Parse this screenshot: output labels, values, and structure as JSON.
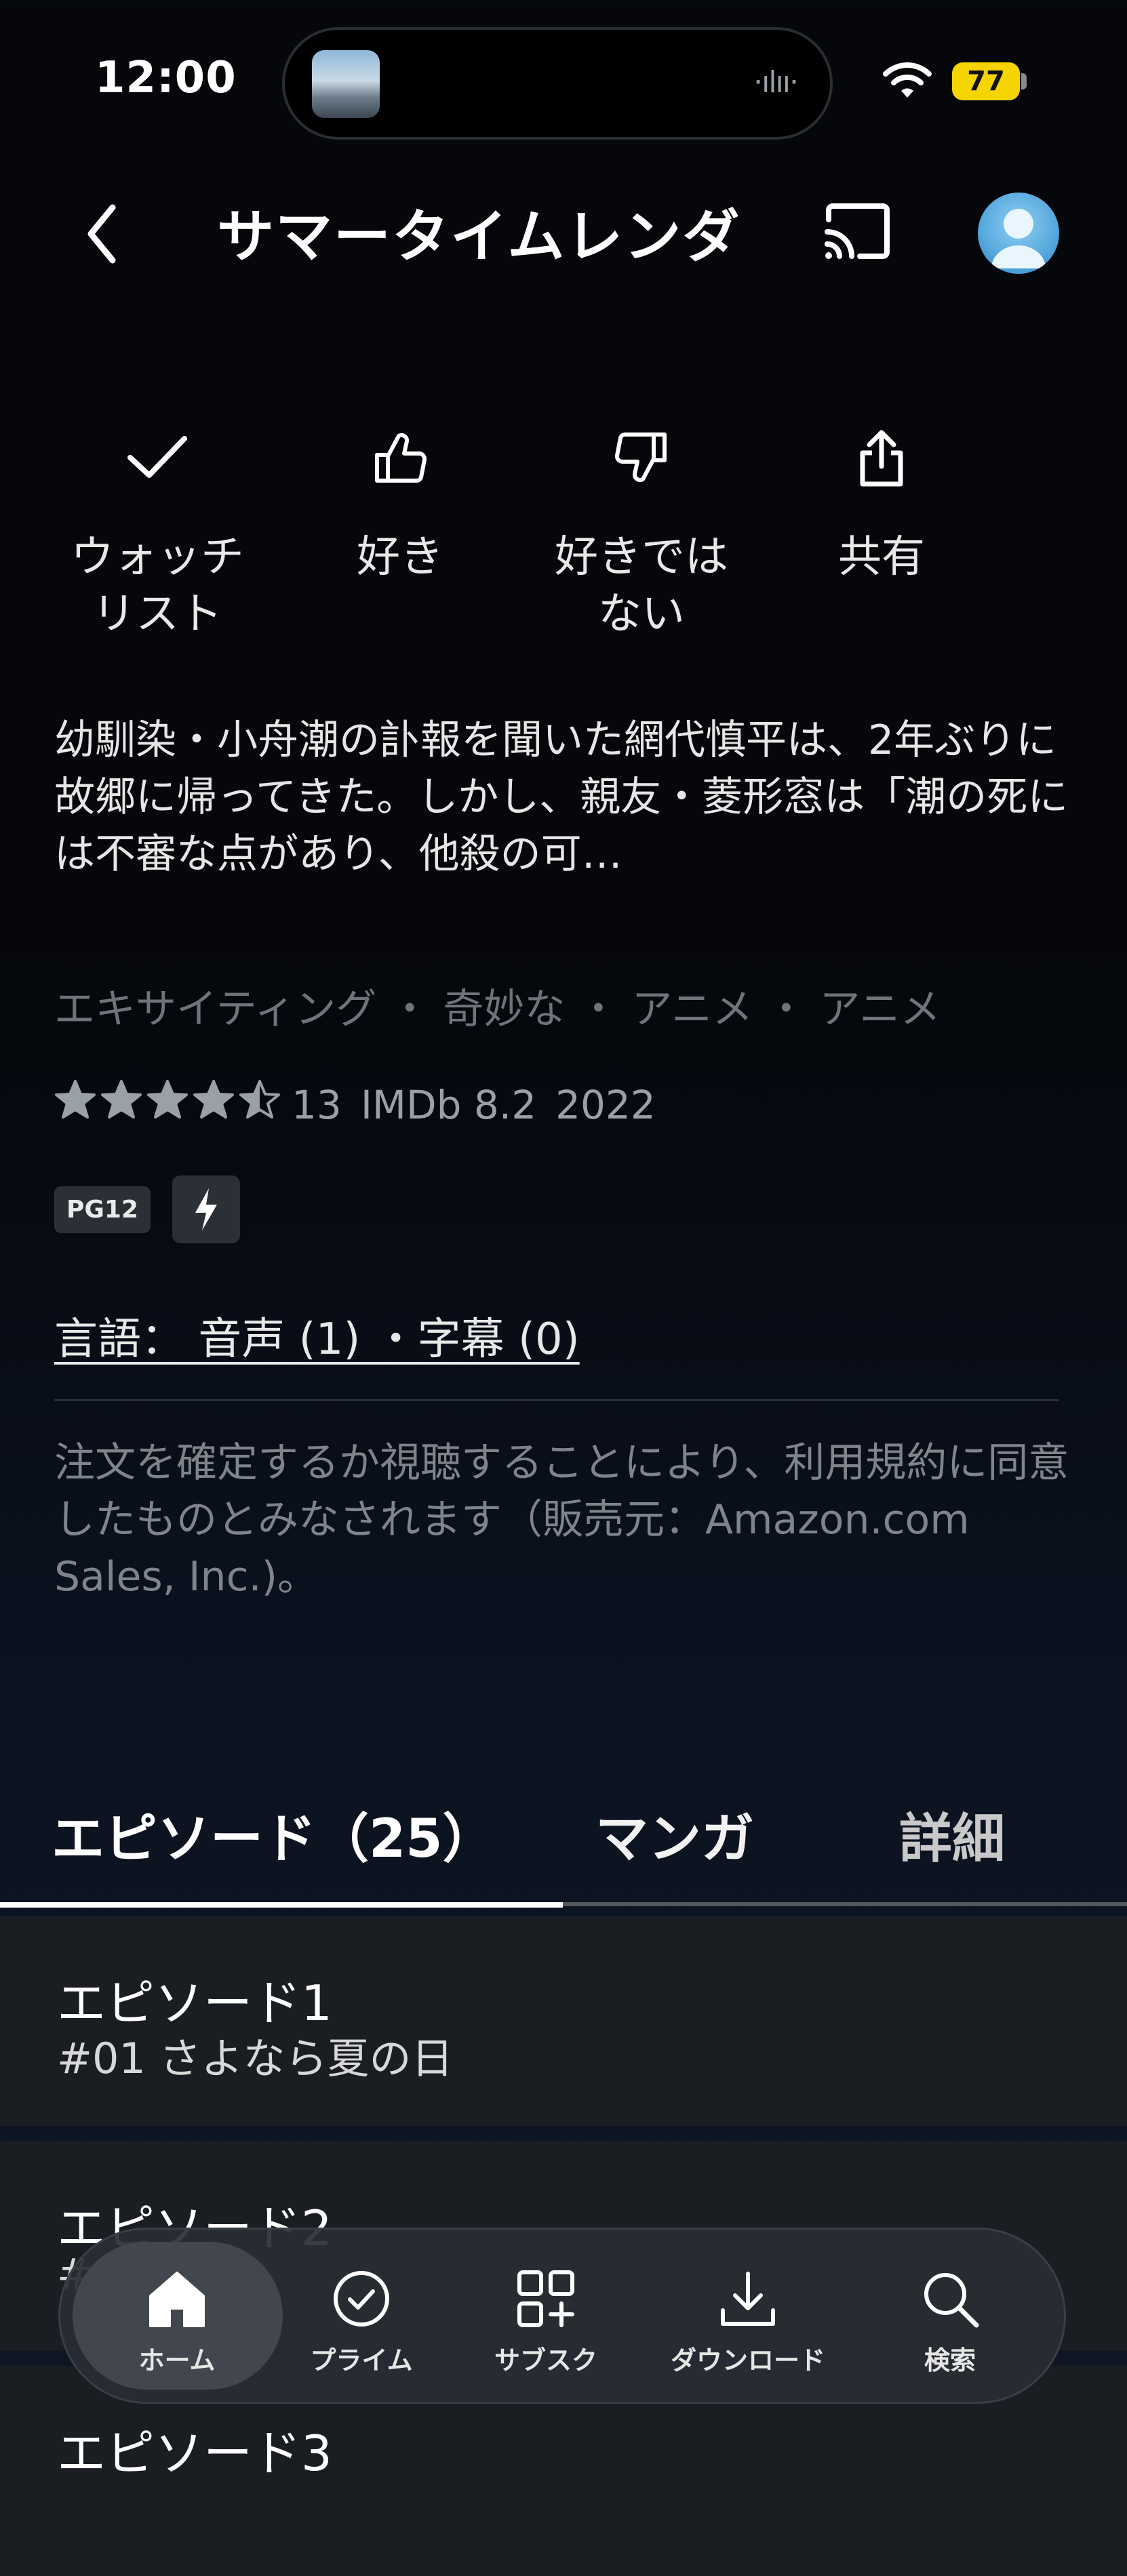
{
  "status_bar": {
    "time": "12:00",
    "battery": "77"
  },
  "header": {
    "title": "サマータイムレンダ"
  },
  "actions": [
    {
      "label_line1": "ウォッチ",
      "label_line2": "リスト",
      "icon": "check-icon"
    },
    {
      "label_line1": "好き",
      "label_line2": "",
      "icon": "thumbs-up-icon"
    },
    {
      "label_line1": "好きでは",
      "label_line2": "ない",
      "icon": "thumbs-down-icon"
    },
    {
      "label_line1": "共有",
      "label_line2": "",
      "icon": "share-icon"
    }
  ],
  "synopsis": "幼馴染・小舟潮の訃報を聞いた網代慎平は、2年ぶりに故郷に帰ってきた。しかし、親友・菱形窓は「潮の死には不審な点があり、他殺の可…",
  "tags": "エキサイティング ・ 奇妙な ・ アニメ ・ アニメ",
  "rating": {
    "stars": 4.5,
    "count": "13",
    "imdb": "IMDb 8.2",
    "year": "2022"
  },
  "badges": {
    "pg": "PG12"
  },
  "language": "言語： 音声 (1) ・字幕 (0)",
  "legal": "注文を確定するか視聴することにより、利用規約に同意したものとみなされます（販売元：Amazon.com Sales, Inc.)。",
  "tabs": [
    {
      "label": "エピソード（25）"
    },
    {
      "label": "マンガ"
    },
    {
      "label": "詳細"
    }
  ],
  "episodes": [
    {
      "title": "エピソード1",
      "subtitle": "#01 さよなら夏の日"
    },
    {
      "title": "エピソード2",
      "subtitle": "#02"
    },
    {
      "title": "エピソード3",
      "subtitle": ""
    }
  ],
  "bottom_nav": [
    {
      "label": "ホーム",
      "icon": "home-icon"
    },
    {
      "label": "プライム",
      "icon": "check-circle-icon"
    },
    {
      "label": "サブスク",
      "icon": "grid-plus-icon"
    },
    {
      "label": "ダウンロード",
      "icon": "download-icon"
    },
    {
      "label": "検索",
      "icon": "search-icon"
    }
  ],
  "colors": {
    "background": "#05070b",
    "accent_battery": "#f5d400",
    "muted_text": "#6f737a"
  }
}
